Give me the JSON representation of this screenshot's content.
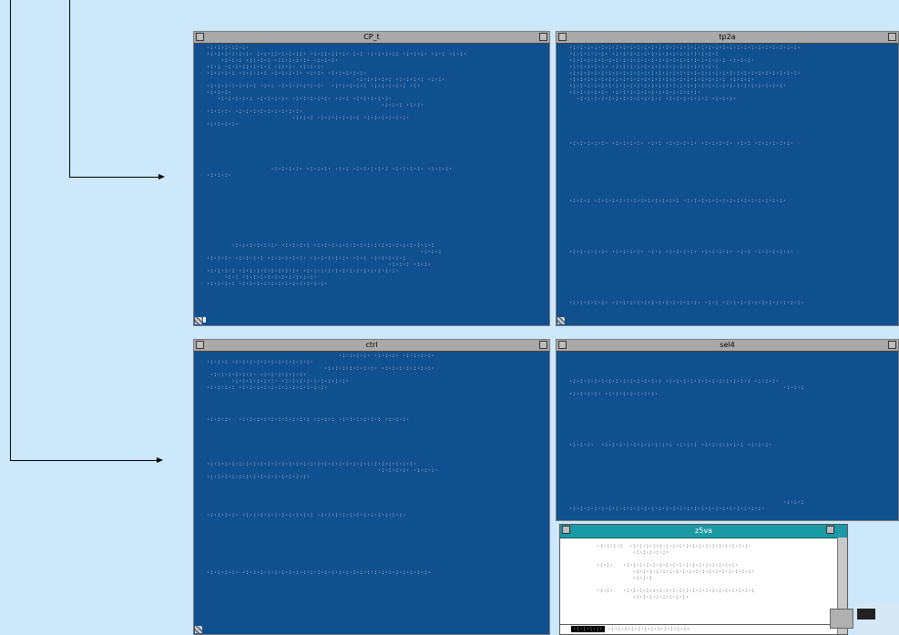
{
  "windows": [
    {
      "title": "CP_t",
      "lines": [
        "  ·:·:·:·::·:·",
        "  ·:·:·:·:·:·:· :·:·::·:·:·::· ·:·::·::·:· :·: ·:·:·:·:: ·:·:·:· ·:·: ·:·:·",
        "      ·:·:·: ·::·:·: ·::·:·:·:· ·:·:·:·",
        "  ·:·: ·:·:·::·:·:·: ·::·:· ·:·:·:·",
        "  ·:·:·:·: ·:·:·:·: ·:·:·:·:· ·:·:· ·:·:·:·:·:·",
        "                                            ·:·:·:·:·: ·:·:·:·: ·:·:·",
        "  ·:·:·:·:·:·:·: ·:·: ·:·:·:·:·:·:·  ·:·:·:·:·: ·:·:·:·:·: ·:·",
        "  ·:·:·:·",
        "     ·:·:·:·:·: ·:·:·:·:· ·:·:·:·:·:· ·:·: ·:·:·:·:·:·",
        "                                                   ·:·:·: ·:·:·",
        "  ·:·:·:· ·:·:·:·:·:·:·:·:·:·",
        "                          ·:·:·: ·:·:·:·:·:·: ·:·:·:·:·:·:·",
        "  ·:·:·:·:·",
        "",
        "",
        "",
        "",
        "",
        "",
        "                    ·:·:·:·:· ·:·:·:· ·:·: ·:·:·:·:·: ·:·:·:·:· ·:·:·:·",
        "  ·:·:·:·",
        "",
        "",
        "",
        "",
        "",
        "",
        "",
        "",
        "",
        "",
        "         ·:·:·:·:·:·:· ·:·:·:·: ·:·:·:·:·:·:·:·:·:·:·:·:·:·:·:·:·:",
        "                                                              ·:·:·:",
        "  ·:·:·:· ·:·:·:·: ·:·:·:·:·:· ·:·:·:·:·:· ·:·: ·:·:·:·:·:",
        "                                                     ·:·:·: ·:·:·",
        "  ·:·:·:·: ·:·:·:·:·:·:·:·:· ·:·:·:·:·:·:·:·:·:·:·:·:·:·",
        "       ·:·: ·:·:·:·:·:·:·:·:·:·:·",
        "  ·:·:·:·: ·:·:·:·:·:·:·:·:·:·:·:·:·"
      ]
    },
    {
      "title": "tp2a",
      "lines": [
        "  ·:·:·:·:·:·:·:·:·:·:·:·:·:·:·:·:·:·:·:·:·:·:·:·:·:·:·:·:·:·:·:·:·",
        "  ·:·:·:·:·:· ·:·:·:·:·:·:·:·:·:·:·:·:·:·:·:",
        "  ·:·:·:·:·:·:·:·:·:·:·:·:·:·:·:·:·:·:·:·:·:·: ·:·:·:·",
        "  ·:·:·:·:·:· ·:·:·:·:·:·:·:·:·:·:·:·:·:·:·:",
        "  ·:·:·:·:·:·:·:·:·:·:·:·:·:·:·:·:·:·:·:·:·:·:·:·:·:·:·:·:·:·:·:·:·",
        "  ·:·:·:·:·:·:·:·:·:·:·:·:·:·:·:·:·:·:·:·:·:·: ·:·:·:·",
        "  ·:·:·:·:·:·:·:·:·:·:·:·:·:·:·:·:·:·:·:·:·:·:·:·:·:·:·:·:·:·:·",
        "  ·:·:·:·:·:· ·:·:·:·:·:·:·:·:·:·:·:·:·",
        "    ·:·:·:·:·:·:·:·:·:·:·:·: ·:·:·:·:·:·: ·:·:·:·",
        "",
        "",
        "",
        "",
        "",
        "",
        "  ·:·:·:·:·:· ·:·:·:·:· ·:·: ·:·:·:·:· ·:·:·:·:· ·:·: ·:·:·:·:·:·",
        "",
        "",
        "",
        "",
        "",
        "",
        "",
        "",
        "  ·:·:·: ·:·:·:·:·:·:·:·:·:·:·:·: ·:·:·:·:·:·:·:·:·:·:·:·:·:·:·",
        "",
        "",
        "",
        "",
        "",
        "",
        "",
        "  ·:·:·:·:·:· ·:·:·:·:· ·:·: ·:·:·:·:· ·:·:·:·:· ·:·: ·:·:·:·:·:·",
        "",
        "",
        "",
        "",
        "",
        "",
        "",
        "  ·:·:·:·:·:· ·:·:·:·:·:·:·:·:·:·:·:·:· ·:·: ·:·:·:·:·:·:·:·:·:·:·:·"
      ]
    },
    {
      "title": "ctrl",
      "lines": [
        "                                       ·:·:·:·:· ·:·:·:· ·:·:·:·:·",
        "  ·:·:·: ·:·:·:·:·:·:·:·:·:·:·:·",
        "                                   ·:·:·:·:·:·:·:· ·:·:·:·:·:·:·:·",
        "   ·:·:·:·:·:·:· ·:·:·:·:·:·:·",
        "         ·:·:·:·:·:·:· ·:·:·:·:·:·:·:·:·:·",
        "  ·:·:·:·: ·:·:·:·:·:·:·:·:·:·:·:·:·",
        "",
        "",
        "",
        "",
        "  ·:·:·:·  ·:·:·:·:·:·:·:·:·:·: ·:·:·: ·:·:·:·:·:·: ·:·:·:·",
        "",
        "",
        "",
        "",
        "",
        "",
        "  ·:·:·:·:·:·:·:·:·:·:·:·:·:·:·:·:·:·:·:·:·:·:·:·:·:·:·:·:·:·",
        "                                                  ·:·:·:·:· ·:·:·:·",
        "  ·:·:·:·:·:·:·:·:·:·:·:·:·:·:·",
        "",
        "",
        "",
        "",
        "",
        "  ·:·:·:·:· ·:·:·:·:·:·:·:·:·:·: ·:·:·:·:·:·:·:·:·:·:·:·:·",
        "",
        "",
        "",
        "",
        "",
        "",
        "",
        "",
        "  ·:·:·:·:· ·:·:·:·:·:·:·:·:·:·:·:·:·:·:·:·:·:·:·:·:·:·:·:·:·:·:·"
      ]
    },
    {
      "title": "sel4",
      "lines": [
        "",
        "",
        "",
        "",
        "  ·:·:·:·:·:·:·:·:·:·:·:·:·: ·:·:·:·:·:·:·:·:·:·:·:·: ·:·:·:·",
        "                                                              ·:·:·:",
        "  ·:·:·:·:· ·:·:·:·:·:·:·:·",
        "",
        "",
        "",
        "",
        "",
        "",
        "",
        "  ·:·:·:·  ·:·:·:·:·:·:·:·:·:·: ·:·:·: ·:·:·:·:·:·: ·:·:·:·",
        "",
        "",
        "",
        "",
        "",
        "",
        "",
        "",
        "                                                              ·:·:·:",
        "  ·:·:·:·:·:·:·:·:·:·:·:·:·:·:·:·:·:·:·:·:·:·:·:·:·:·:·:·"
      ]
    }
  ],
  "help": {
    "title": "z5va",
    "lines": [
      "·:·:·:·:  ·:·:·:·:·:·:·:·:·:·:·:·:·:·:·:·:·:·:·",
      "           ·:·:·:·:·:·",
      "",
      "·:·:·   ·:·:·:·:·:·:·:·:·:·:·:·:·:·:·:·:·:·",
      "           ·:·:·:·:·:·:·:·:·:·:·:·:·:·:·:·:·:·:·",
      "           ·:·:·:",
      "",
      "·:·:·   ·:·:·:·:·:·:·:·:·:·:·:·:·:·:·:·:·:·:·:·:",
      "           ·:·:·:·:·:·:·:·:·"
    ],
    "input_prompt": "·:·:·:·:·",
    "input_text": "·:·:·:·:·:·:·:·:·:·:·:·:·"
  }
}
